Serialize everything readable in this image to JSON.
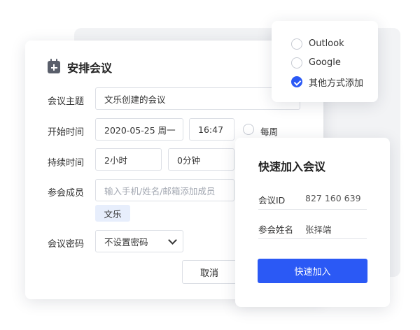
{
  "schedule": {
    "title": "安排会议",
    "topic_label": "会议主题",
    "topic_value": "文乐创建的会议",
    "start_label": "开始时间",
    "start_date": "2020-05-25 周一",
    "start_time": "16:47",
    "repeat_label": "每周",
    "duration_label": "持续时间",
    "duration_hours": "2小时",
    "duration_minutes": "0分钟",
    "members_label": "参会成员",
    "members_placeholder": "输入手机/姓名/邮箱添加成员",
    "member_tag": "文乐",
    "password_label": "会议密码",
    "password_value": "不设置密码",
    "cancel_label": "取消"
  },
  "add_options": {
    "items": [
      {
        "label": "Outlook",
        "checked": false
      },
      {
        "label": "Google",
        "checked": false
      },
      {
        "label": "其他方式添加",
        "checked": true
      }
    ]
  },
  "join": {
    "title": "快速加入会议",
    "id_label": "会议ID",
    "id_value": "827 160 639",
    "name_label": "参会姓名",
    "name_value": "张择端",
    "join_button": "快速加入"
  },
  "colors": {
    "accent": "#2b59f5",
    "tag_bg": "#e7eefc",
    "panel_bg": "#f2f3f5"
  },
  "icons": {
    "title_icon": "calendar-add-icon",
    "select_arrow": "chevron-down-icon",
    "radio_checked": "check-icon"
  }
}
